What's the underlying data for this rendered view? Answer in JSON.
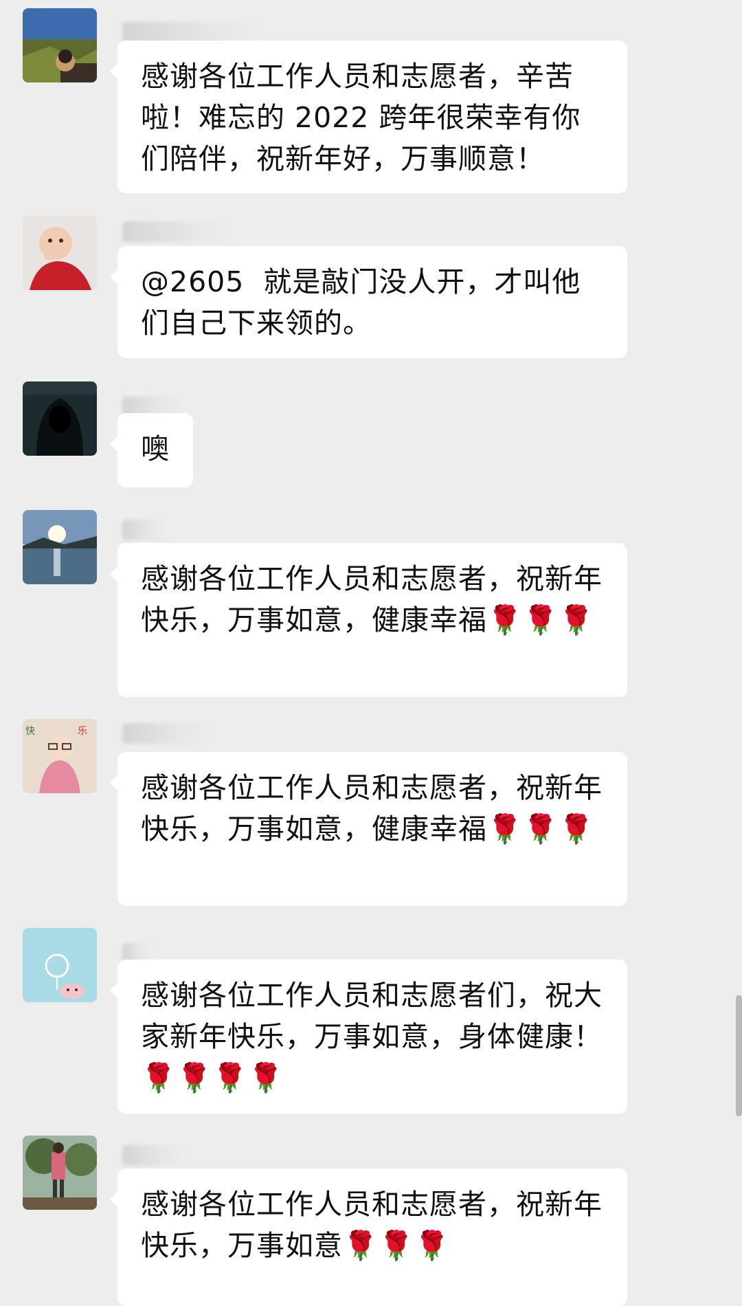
{
  "messages": [
    {
      "text": "感谢各位工作人员和志愿者，辛苦啦！难忘的 2022 跨年很荣幸有你们陪伴，祝新年好，万事顺意！",
      "flowers": ""
    },
    {
      "text": "@2605  就是敲门没人开，才叫他们自己下来领的。",
      "flowers": ""
    },
    {
      "text": "噢",
      "flowers": ""
    },
    {
      "text": "感谢各位工作人员和志愿者，祝新年快乐，万事如意，健康幸福",
      "flowers": "🌹🌹🌹"
    },
    {
      "text": "感谢各位工作人员和志愿者，祝新年快乐，万事如意，健康幸福",
      "flowers": "🌹🌹🌹"
    },
    {
      "text": "感谢各位工作人员和志愿者们，祝大家新年快乐，万事如意，身体健康！",
      "flowers": "🌹🌹🌹🌹"
    },
    {
      "text": "感谢各位工作人员和志愿者，祝新年快乐，万事如意",
      "flowers": "🌹🌹🌹"
    }
  ],
  "colors": {
    "background": "#ededed",
    "bubble": "#ffffff",
    "text": "#111111",
    "rose": "#d0121b",
    "stem": "#3a8a2a"
  }
}
